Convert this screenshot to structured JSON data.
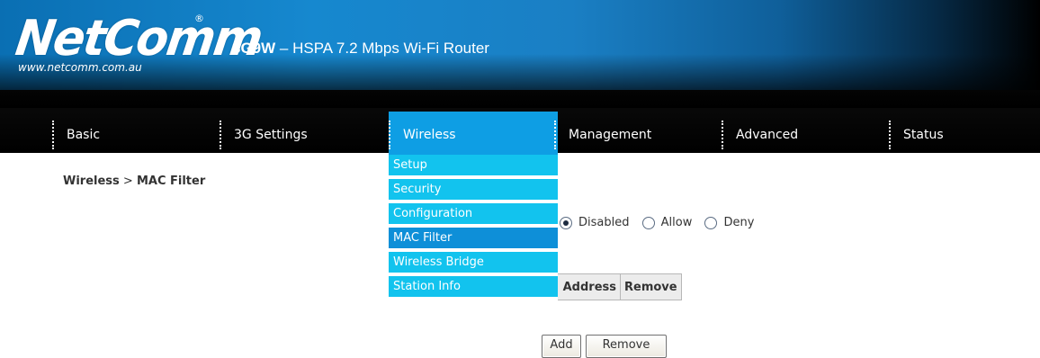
{
  "header": {
    "brand": "NetComm",
    "reg_mark": "®",
    "url": "www.netcomm.com.au",
    "model": "3G9W",
    "title_rest": " – HSPA 7.2 Mbps Wi-Fi Router"
  },
  "nav": {
    "items": [
      {
        "label": "Basic"
      },
      {
        "label": "3G Settings"
      },
      {
        "label": "Wireless"
      },
      {
        "label": "Management"
      },
      {
        "label": "Advanced"
      },
      {
        "label": "Status"
      }
    ],
    "active": "Wireless"
  },
  "dropdown": {
    "items": [
      {
        "label": "Setup"
      },
      {
        "label": "Security"
      },
      {
        "label": "Configuration"
      },
      {
        "label": "MAC Filter"
      },
      {
        "label": "Wireless Bridge"
      },
      {
        "label": "Station Info"
      }
    ],
    "selected": "MAC Filter"
  },
  "breadcrumb": {
    "section": "Wireless",
    "separator": " > ",
    "page": "MAC Filter"
  },
  "filter_mode": {
    "options": [
      {
        "label": "Disabled",
        "checked": true
      },
      {
        "label": "Allow",
        "checked": false
      },
      {
        "label": "Deny",
        "checked": false
      }
    ]
  },
  "table": {
    "headers": [
      "MAC Address",
      "Address",
      "Remove"
    ]
  },
  "buttons": {
    "add": "Add",
    "remove": "Remove"
  },
  "colors": {
    "nav_active": "#0e9ee4",
    "dropdown_item": "#12c3ee",
    "dropdown_selected": "#0e8fd8"
  }
}
